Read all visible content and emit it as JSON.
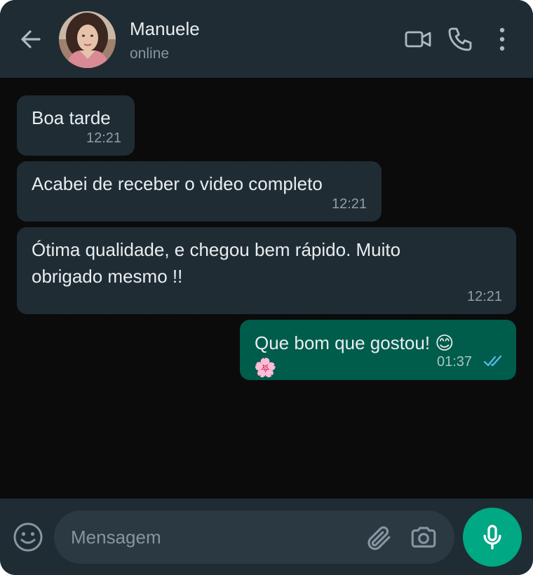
{
  "header": {
    "contact_name": "Manuele",
    "status": "online",
    "icons": {
      "back": "arrow-left-icon",
      "video": "video-camera-icon",
      "call": "phone-icon",
      "menu": "more-vertical-icon"
    }
  },
  "messages": [
    {
      "direction": "incoming",
      "text": "Boa tarde",
      "time": "12:21"
    },
    {
      "direction": "incoming",
      "text": "Acabei de receber o video completo",
      "time": "12:21"
    },
    {
      "direction": "incoming",
      "text_line1": "Ótima qualidade, e chegou bem rápido. Muito",
      "text_line2": "obrigado mesmo !!",
      "time": "12:21"
    },
    {
      "direction": "outgoing",
      "text": "Que bom que gostou! 😊",
      "emoji_line": "🌸",
      "time": "01:37",
      "status": "read"
    }
  ],
  "composer": {
    "placeholder": "Mensagem",
    "value": "",
    "icons": {
      "emoji": "smiley-icon",
      "attach": "paperclip-icon",
      "camera": "camera-icon",
      "mic": "microphone-icon"
    }
  },
  "colors": {
    "header_bg": "#1f2c34",
    "chat_bg": "#0b0b0b",
    "incoming_bubble": "#1f2c34",
    "outgoing_bubble": "#005c4b",
    "accent": "#00a884",
    "read_ticks": "#53bdeb"
  }
}
